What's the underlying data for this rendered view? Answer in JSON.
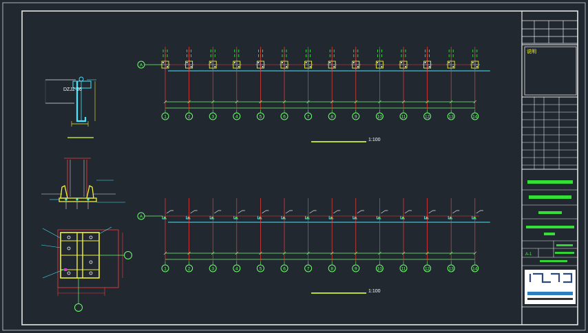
{
  "drawing": {
    "plan1": {
      "row_axis": "A",
      "column_axes": [
        "1",
        "2",
        "3",
        "4",
        "5",
        "6",
        "7",
        "8",
        "9",
        "10",
        "11",
        "12",
        "13",
        "14"
      ],
      "scale": "1:100"
    },
    "plan2": {
      "row_axis": "A",
      "column_axes": [
        "1",
        "2",
        "3",
        "4",
        "5",
        "6",
        "7",
        "8",
        "9",
        "10",
        "11",
        "12",
        "13",
        "14"
      ],
      "scale": "1:100"
    },
    "detail": {
      "section_label": "DZJ2-36"
    },
    "title_block": {
      "notes_header": "说明",
      "sheet_code": "A-1"
    }
  },
  "colors": {
    "background": "#212830",
    "frame": "#e6e6e6",
    "axis_bubble": "#6dff6d",
    "grid_red": "#ff3b3b",
    "cyan": "#48e8ff",
    "yellow": "#f2f23a",
    "green_text": "#39ff39"
  }
}
